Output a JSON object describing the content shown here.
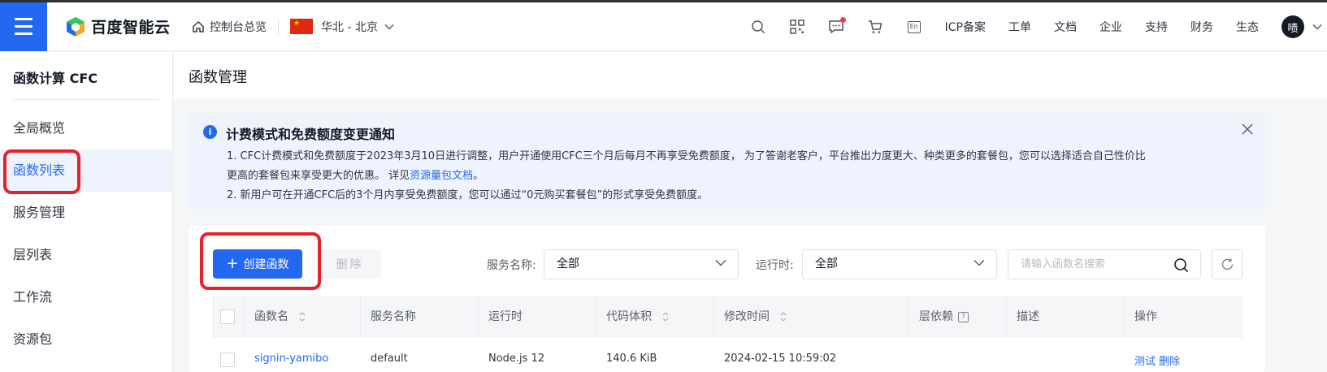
{
  "header": {
    "brand": "百度智能云",
    "console": "控制台总览",
    "region": "华北 - 北京",
    "links": [
      "ICP备案",
      "工单",
      "文档",
      "企业",
      "支持",
      "财务",
      "生态"
    ],
    "avatar": "啧",
    "en_label": "En"
  },
  "sidebar": {
    "title": "函数计算 CFC",
    "items": [
      {
        "label": "全局概览"
      },
      {
        "label": "函数列表"
      },
      {
        "label": "服务管理"
      },
      {
        "label": "层列表"
      },
      {
        "label": "工作流"
      },
      {
        "label": "资源包"
      }
    ]
  },
  "page": {
    "title": "函数管理"
  },
  "notice": {
    "title": "计费模式和免费额度变更通知",
    "line1": "1. CFC计费模式和免费额度于2023年3月10日进行调整，用户开通使用CFC三个月后每月不再享受免费额度， 为了答谢老客户，平台推出力度更大、种类更多的套餐包，您可以选择适合自己性价比",
    "line2_prefix": "更高的套餐包来享受更大的优惠。 详见",
    "line2_link": "资源量包文档",
    "line2_suffix": "。",
    "line3": "2. 新用户可在开通CFC后的3个月内享受免费额度，您可以通过“0元购买套餐包”的形式享受免费额度。"
  },
  "toolbar": {
    "create_label": "创建函数",
    "delete_label": "删除",
    "service_label": "服务名称:",
    "service_value": "全部",
    "runtime_label": "运行时:",
    "runtime_value": "全部",
    "search_placeholder": "请输入函数名搜索"
  },
  "table": {
    "columns": [
      "函数名",
      "服务名称",
      "运行时",
      "代码体积",
      "修改时间",
      "层依赖",
      "描述",
      "操作"
    ],
    "rows": [
      {
        "name": "signin-yamibo",
        "service": "default",
        "runtime": "Node.js 12",
        "size": "140.6 KiB",
        "modified": "2024-02-15 10:59:02",
        "actions": "测试  删除"
      }
    ]
  },
  "colors": {
    "accent": "#2468f2",
    "annotation": "#e8202a"
  }
}
